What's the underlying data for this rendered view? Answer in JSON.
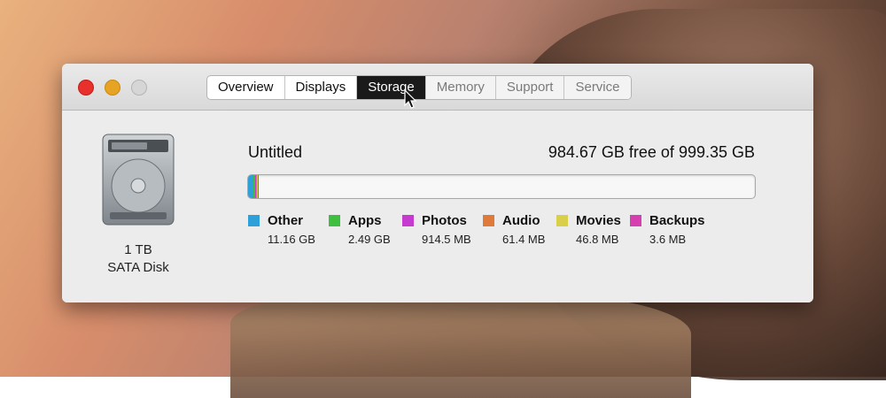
{
  "window": {
    "tabs": [
      {
        "label": "Overview",
        "state": "normal"
      },
      {
        "label": "Displays",
        "state": "normal"
      },
      {
        "label": "Storage",
        "state": "active"
      },
      {
        "label": "Memory",
        "state": "disabled"
      },
      {
        "label": "Support",
        "state": "disabled"
      },
      {
        "label": "Service",
        "state": "disabled"
      }
    ]
  },
  "disk": {
    "size": "1 TB",
    "type": "SATA Disk",
    "icon": "hard-drive-icon"
  },
  "storage": {
    "volume_name": "Untitled",
    "free_text": "984.67 GB free of 999.35 GB",
    "total_gb": 999.35,
    "categories": [
      {
        "label": "Other",
        "value": "11.16 GB",
        "gb": 11.16,
        "color": "#2d9fd9"
      },
      {
        "label": "Apps",
        "value": "2.49 GB",
        "gb": 2.49,
        "color": "#3fbf3f"
      },
      {
        "label": "Photos",
        "value": "914.5 MB",
        "gb": 0.9145,
        "color": "#c63ad0"
      },
      {
        "label": "Audio",
        "value": "61.4 MB",
        "gb": 0.0614,
        "color": "#e07a3a"
      },
      {
        "label": "Movies",
        "value": "46.8 MB",
        "gb": 0.0468,
        "color": "#d9cf4a"
      },
      {
        "label": "Backups",
        "value": "3.6 MB",
        "gb": 0.0036,
        "color": "#d53fb0"
      }
    ]
  }
}
